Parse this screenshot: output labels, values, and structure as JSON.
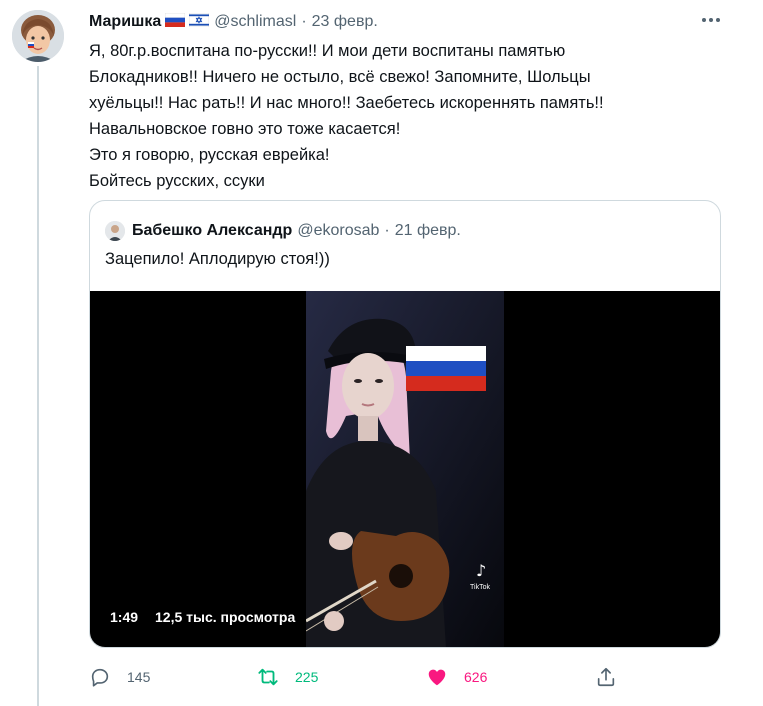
{
  "tweet": {
    "author_name": "Маришка",
    "flags": [
      "russia-flag-icon",
      "israel-flag-icon"
    ],
    "handle": "@schlimasl",
    "separator": "·",
    "date": "23 февр.",
    "text_lines": [
      "Я, 80г.р.воспитана по-русски!! И мои дети воспитаны памятью",
      "Блокадников!! Ничего не остыло, всё свежо! Запомните, Шольцы",
      "хуёльцы!! Нас рать!! И нас много!! Заебетесь искореннять память!!",
      "Навальновское говно это тоже касается!",
      "Это я говорю, русская еврейка!",
      "Бойтесь русских, ссуки"
    ]
  },
  "quote": {
    "author_name": "Бабешко Александр",
    "handle": "@ekorosab",
    "separator": "·",
    "date": "21 февр.",
    "text": "Зацепило! Аплодирую стоя!))",
    "media": {
      "duration": "1:49",
      "views": "12,5 тыс. просмотра",
      "watermark": "TikTok"
    }
  },
  "actions": {
    "reply_count": "145",
    "retweet_count": "225",
    "like_count": "626"
  },
  "colors": {
    "text": "#0f1419",
    "secondary": "#536471",
    "border": "#cfd9de",
    "retweet_active": "#00ba7c",
    "like_active": "#f91880"
  }
}
